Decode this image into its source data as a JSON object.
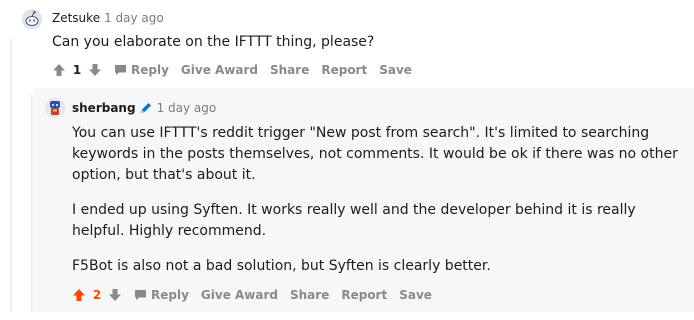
{
  "colors": {
    "accent_upvote": "#ff4500",
    "meta_gray": "#7c7c7c",
    "action_gray": "#878a8c",
    "moderator_blue": "#0079d3",
    "highlight_bg": "#f6f7f8"
  },
  "comment": {
    "username": "Zetsuke",
    "timestamp": "1 day ago",
    "body": "Can you elaborate on the IFTTT thing, please?",
    "score": "1",
    "actions": {
      "reply": "Reply",
      "give_award": "Give Award",
      "share": "Share",
      "report": "Report",
      "save": "Save"
    },
    "icons": [
      "upvote-icon",
      "downvote-icon",
      "reply-bubble-icon"
    ]
  },
  "reply": {
    "username": "sherbang",
    "timestamp": "1 day ago",
    "badge_icon": "pencil-icon",
    "paragraphs": [
      "You can use IFTTT's reddit trigger \"New post from search\". It's limited to searching keywords in the posts themselves, not comments. It would be ok if there was no other option, but that's about it.",
      "I ended up using Syften. It works really well and the developer behind it is really helpful. Highly recommend.",
      "F5Bot is also not a bad solution, but Syften is clearly better."
    ],
    "score": "2",
    "upvoted": true,
    "actions": {
      "reply": "Reply",
      "give_award": "Give Award",
      "share": "Share",
      "report": "Report",
      "save": "Save"
    }
  }
}
